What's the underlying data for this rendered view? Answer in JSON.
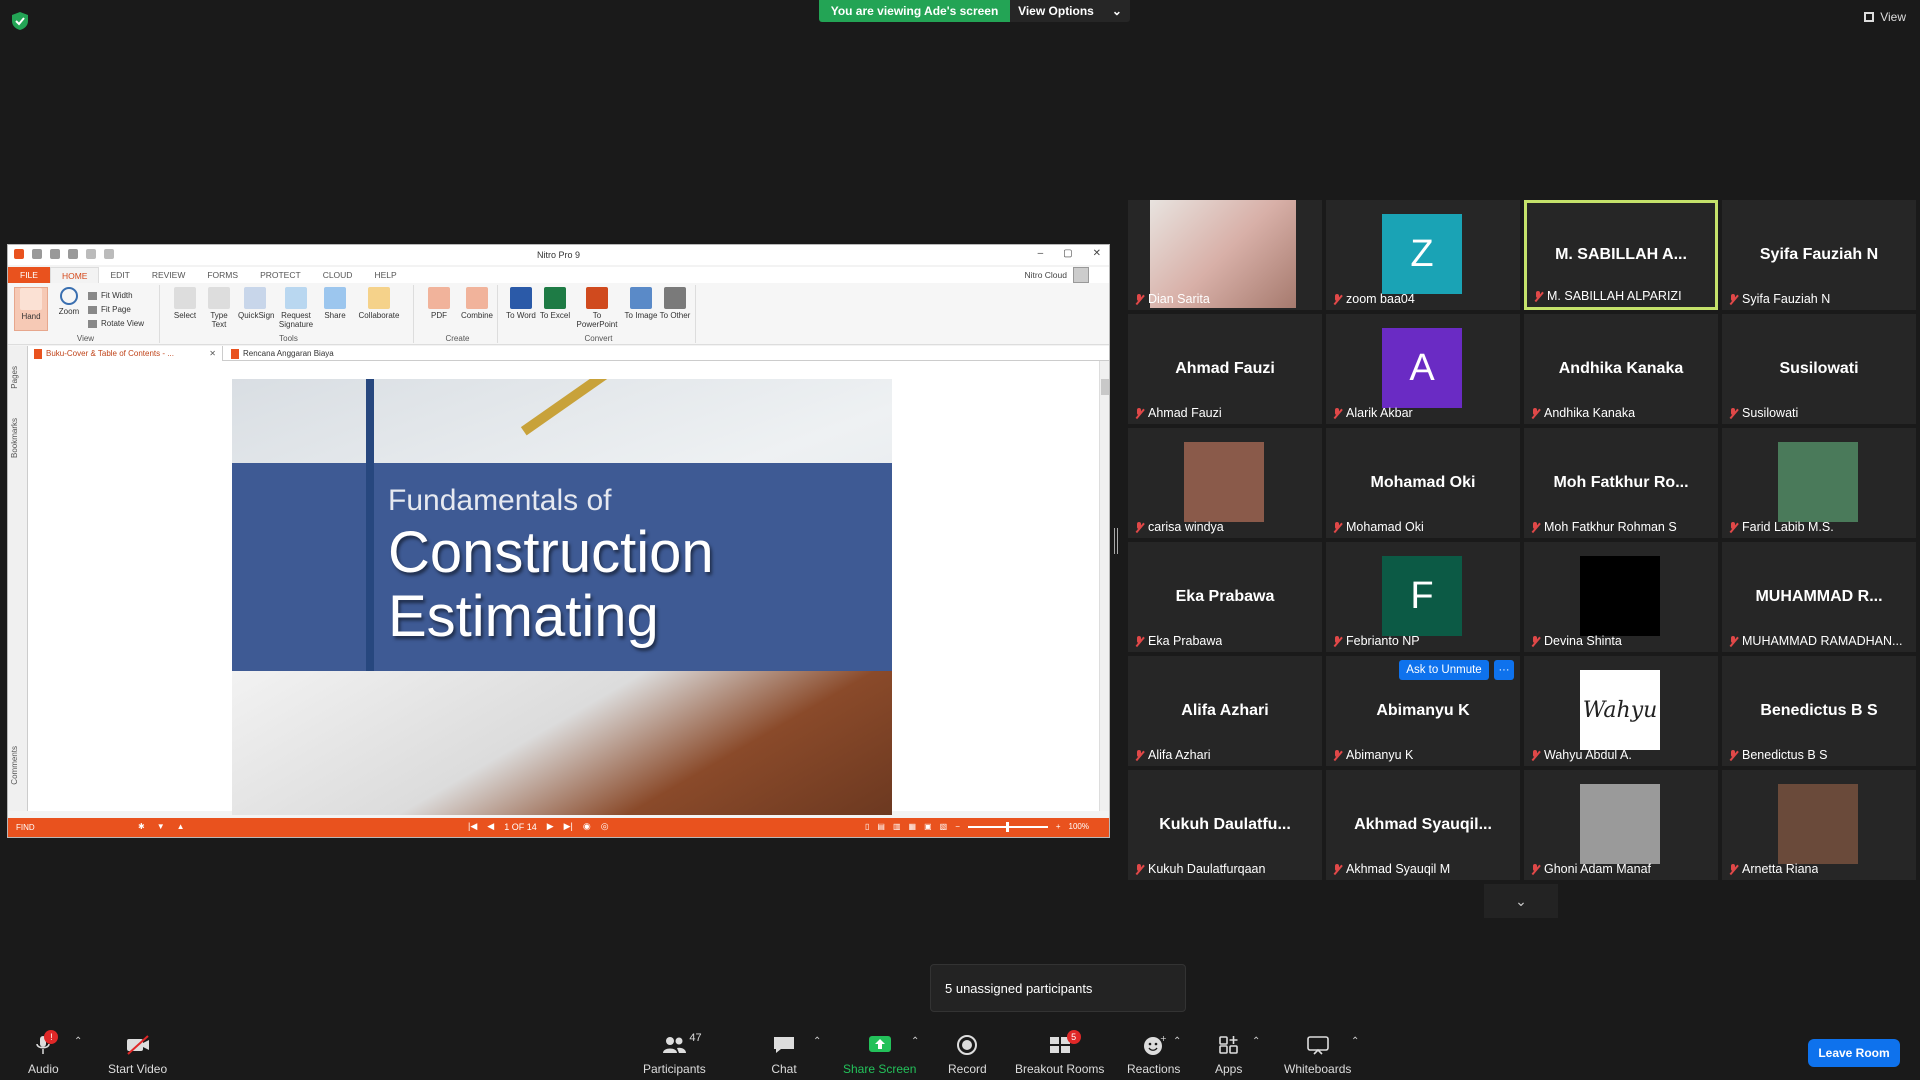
{
  "top": {
    "viewing_banner": "You are viewing Ade's screen",
    "view_options": "View Options",
    "view_button": "View"
  },
  "nitro": {
    "title": "Nitro Pro 9",
    "menu_tabs": [
      "FILE",
      "HOME",
      "EDIT",
      "REVIEW",
      "FORMS",
      "PROTECT",
      "CLOUD",
      "HELP"
    ],
    "cloud_label": "Nitro Cloud",
    "ribbon": {
      "hand": "Hand",
      "zoom": "Zoom",
      "fit_width": "Fit Width",
      "fit_page": "Fit Page",
      "rotate_view": "Rotate View",
      "view_group": "View",
      "select": "Select",
      "type_text": "Type Text",
      "quicksign": "QuickSign",
      "request_signature": "Request Signature",
      "share": "Share",
      "collaborate": "Collaborate",
      "tools_group": "Tools",
      "pdf": "PDF",
      "combine": "Combine",
      "create_group": "Create",
      "to_word": "To Word",
      "to_excel": "To Excel",
      "to_powerpoint": "To PowerPoint",
      "to_image": "To Image",
      "to_other": "To Other",
      "convert_group": "Convert"
    },
    "doc_tabs": [
      "Buku-Cover & Table of Contents - ...",
      "Rencana Anggaran Biaya"
    ],
    "side_labels": [
      "Pages",
      "Bookmarks",
      "Comments"
    ],
    "cover": {
      "subtitle": "Fundamentals of",
      "title_line1": "Construction",
      "title_line2": "Estimating"
    },
    "status": {
      "find": "FIND",
      "page": "1 OF 14",
      "zoom": "100%"
    }
  },
  "participants": [
    {
      "display": "",
      "label": "Dian Sarita",
      "kind": "photo",
      "color": "#c9a6a0"
    },
    {
      "display": "Z",
      "label": "zoom baa04",
      "kind": "letter",
      "color": "#1aa3b5"
    },
    {
      "display": "M. SABILLAH A...",
      "label": "M. SABILLAH ALPARIZI",
      "kind": "name",
      "speaker": true
    },
    {
      "display": "Syifa Fauziah N",
      "label": "Syifa Fauziah N",
      "kind": "name"
    },
    {
      "display": "Ahmad Fauzi",
      "label": "Ahmad Fauzi",
      "kind": "name"
    },
    {
      "display": "A",
      "label": "Alarik Akbar",
      "kind": "letter",
      "color": "#6a2bc4"
    },
    {
      "display": "Andhika Kanaka",
      "label": "Andhika Kanaka",
      "kind": "name"
    },
    {
      "display": "Susilowati",
      "label": "Susilowati",
      "kind": "name"
    },
    {
      "display": "",
      "label": "carisa windya",
      "kind": "photo",
      "color": "#8a5a4a"
    },
    {
      "display": "Mohamad Oki",
      "label": "Mohamad Oki",
      "kind": "name"
    },
    {
      "display": "Moh Fatkhur Ro...",
      "label": "Moh Fatkhur Rohman S",
      "kind": "name"
    },
    {
      "display": "",
      "label": "Farid Labib M.S.",
      "kind": "photo",
      "color": "#4a7a5a"
    },
    {
      "display": "Eka Prabawa",
      "label": "Eka Prabawa",
      "kind": "name"
    },
    {
      "display": "F",
      "label": "Febrianto NP",
      "kind": "letter",
      "color": "#0c5a45"
    },
    {
      "display": "",
      "label": "Devina Shinta",
      "kind": "photo",
      "color": "#000000"
    },
    {
      "display": "MUHAMMAD  R...",
      "label": "MUHAMMAD RAMADHAN...",
      "kind": "name"
    },
    {
      "display": "Alifa Azhari",
      "label": "Alifa Azhari",
      "kind": "name"
    },
    {
      "display": "Abimanyu K",
      "label": "Abimanyu K",
      "kind": "name"
    },
    {
      "display": "",
      "label": "Wahyu Abdul A.",
      "kind": "photo",
      "color": "#ffffff"
    },
    {
      "display": "Benedictus B S",
      "label": "Benedictus B S",
      "kind": "name"
    },
    {
      "display": "Kukuh  Daulatfu...",
      "label": "Kukuh Daulatfurqaan",
      "kind": "name"
    },
    {
      "display": "Akhmad  Syauqil...",
      "label": "Akhmad Syauqil M",
      "kind": "name"
    },
    {
      "display": "",
      "label": "Ghoni Adam Manaf",
      "kind": "photo",
      "color": "#9a9a9a"
    },
    {
      "display": "",
      "label": "Arnetta Riana",
      "kind": "photo",
      "color": "#6a4a3a"
    }
  ],
  "ask_unmute": "Ask to Unmute",
  "more": "···",
  "photo_text": {
    "wahyu": "Wahyu"
  },
  "unassigned": "5 unassigned participants",
  "toolbar": {
    "audio": "Audio",
    "start_video": "Start Video",
    "participants": "Participants",
    "participants_count": "47",
    "chat": "Chat",
    "share_screen": "Share Screen",
    "record": "Record",
    "breakout_rooms": "Breakout Rooms",
    "breakout_badge": "5",
    "reactions": "Reactions",
    "apps": "Apps",
    "whiteboards": "Whiteboards",
    "leave": "Leave Room",
    "audio_badge": "!"
  },
  "colors": {
    "accent_green": "#23a455",
    "zoom_blue": "#0e72ed",
    "nitro_orange": "#e9521e",
    "speaker_border": "#c5e26b"
  }
}
